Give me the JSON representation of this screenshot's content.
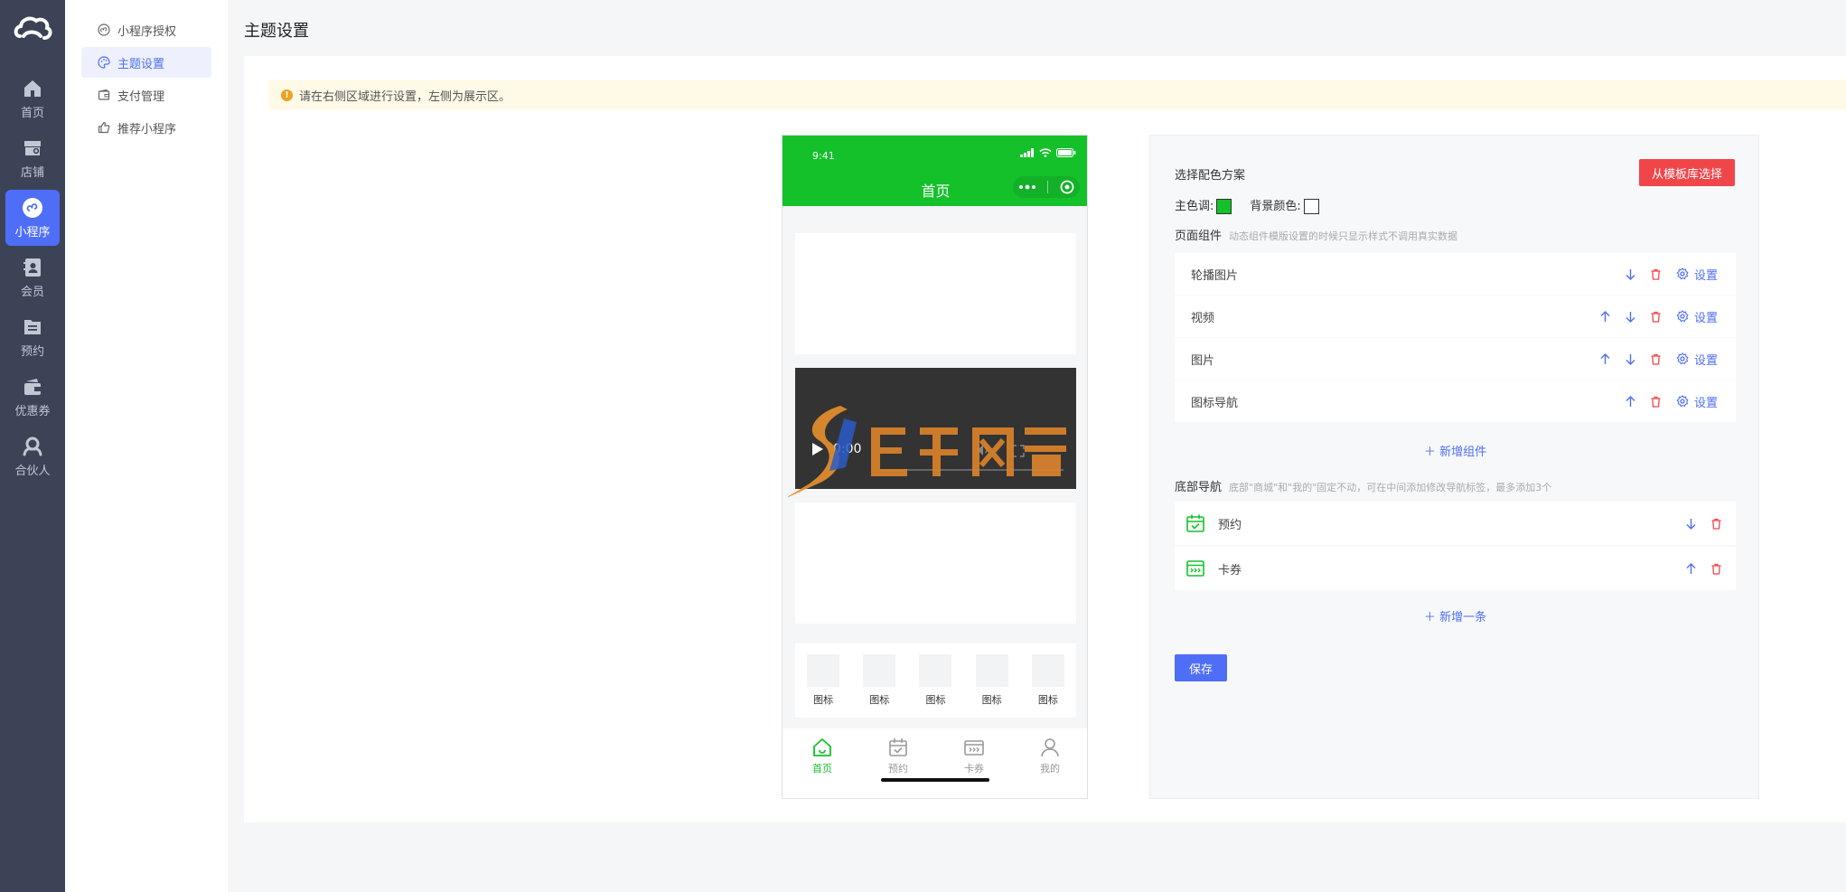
{
  "rail": {
    "items": [
      {
        "label": "首页",
        "icon": "home-icon"
      },
      {
        "label": "店铺",
        "icon": "store-icon"
      },
      {
        "label": "小程序",
        "icon": "mini-program-icon"
      },
      {
        "label": "会员",
        "icon": "member-icon"
      },
      {
        "label": "预约",
        "icon": "appointment-icon"
      },
      {
        "label": "优惠券",
        "icon": "coupon-icon"
      },
      {
        "label": "合伙人",
        "icon": "partner-icon"
      }
    ],
    "active_index": 2
  },
  "subnav": {
    "items": [
      {
        "label": "小程序授权",
        "icon": "authorize-icon"
      },
      {
        "label": "主题设置",
        "icon": "palette-icon"
      },
      {
        "label": "支付管理",
        "icon": "wallet-icon"
      },
      {
        "label": "推荐小程序",
        "icon": "thumb-up-icon"
      }
    ],
    "active_index": 1
  },
  "page": {
    "title": "主题设置",
    "notice": "请在右侧区域进行设置，左侧为展示区。"
  },
  "phone": {
    "time": "9:41",
    "title": "首页",
    "video_time": "0:00",
    "icon_label": "图标",
    "tabs": [
      {
        "label": "首页",
        "icon": "home-outline-icon"
      },
      {
        "label": "预约",
        "icon": "calendar-check-icon"
      },
      {
        "label": "卡券",
        "icon": "ticket-icon"
      },
      {
        "label": "我的",
        "icon": "user-icon"
      }
    ],
    "theme_color": "#14c12b"
  },
  "panel": {
    "color_scheme_label": "选择配色方案",
    "template_button": "从模板库选择",
    "main_color_label": "主色调:",
    "main_color": "#14c12b",
    "bg_color_label": "背景颜色:",
    "bg_color": "#ffffff",
    "components_label": "页面组件",
    "components_hint": "动态组件模版设置的时候只显示样式不调用真实数据",
    "components": [
      {
        "name": "轮播图片"
      },
      {
        "name": "视频"
      },
      {
        "name": "图片"
      },
      {
        "name": "图标导航"
      }
    ],
    "settings_label": "设置",
    "add_component": "新增组件",
    "bottom_nav_label": "底部导航",
    "bottom_nav_hint": "底部\"商城\"和\"我的\"固定不动，可在中间添加修改导航标签，最多添加3个",
    "nav_items": [
      {
        "name": "预约",
        "icon": "calendar-check-icon"
      },
      {
        "name": "卡券",
        "icon": "ticket-icon"
      }
    ],
    "add_nav": "新增一条",
    "save": "保存"
  }
}
